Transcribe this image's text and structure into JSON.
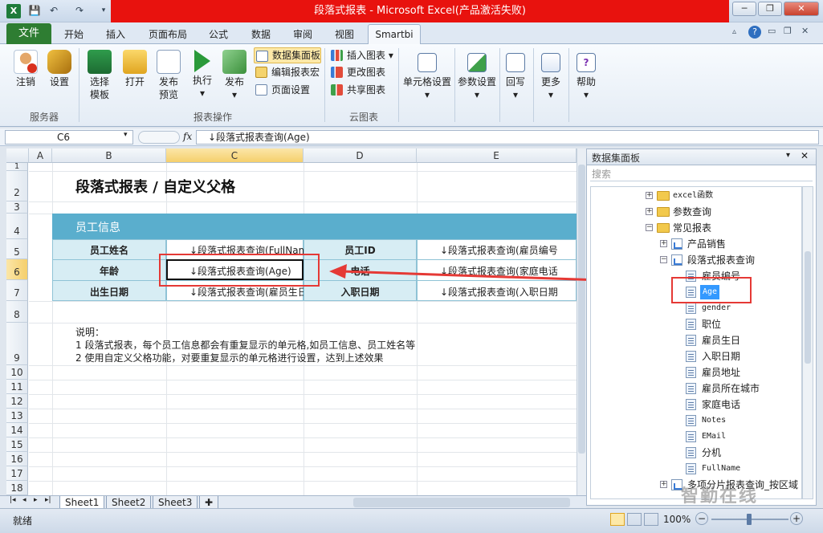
{
  "window": {
    "title": "段落式报表 - Microsoft Excel(产品激活失败)"
  },
  "qat": {
    "save": "💾",
    "undo": "↶",
    "redo": "↷"
  },
  "tabs": [
    "开始",
    "插入",
    "页面布局",
    "公式",
    "数据",
    "审阅",
    "视图"
  ],
  "file_tab": "文件",
  "smartbi_tab": "Smartbi",
  "ribbon": {
    "server": {
      "logout": "注销",
      "settings": "设置",
      "group": "服务器"
    },
    "report": {
      "select_template": "选择",
      "select_template2": "模板",
      "open": "打开",
      "publish_preview": "发布",
      "publish_preview2": "预览",
      "execute": "执行",
      "publish": "发布",
      "dataset_panel": "数据集面板",
      "edit_macro": "编辑报表宏",
      "page_setup": "页面设置",
      "group": "报表操作"
    },
    "cloud": {
      "insert_chart": "插入图表",
      "change_chart": "更改图表",
      "share_chart": "共享图表",
      "group": "云图表"
    },
    "cell_settings": "单元格设置",
    "param_settings": "参数设置",
    "writeback": "回写",
    "more": "更多",
    "help": "帮助"
  },
  "formula_bar": {
    "name_box": "C6",
    "fx": "fx",
    "formula": "↓段落式报表查询(Age)"
  },
  "columns": [
    "A",
    "B",
    "C",
    "D",
    "E"
  ],
  "rows": [
    "1",
    "2",
    "3",
    "4",
    "5",
    "6",
    "7",
    "8",
    "9",
    "10",
    "11",
    "12",
    "13",
    "14",
    "15",
    "16",
    "17",
    "18"
  ],
  "sheet": {
    "title": "段落式报表 / 自定义父格",
    "section_header": "员工信息",
    "r5": [
      "员工姓名",
      "↓段落式报表查询(FullNam",
      "员工ID",
      "↓段落式报表查询(雇员编号"
    ],
    "r6": [
      "年龄",
      "↓段落式报表查询(Age)",
      "电话",
      "↓段落式报表查询(家庭电话"
    ],
    "r7": [
      "出生日期",
      "↓段落式报表查询(雇员生日",
      "入职日期",
      "↓段落式报表查询(入职日期"
    ],
    "notes": [
      "说明：",
      "1 段落式报表，每个员工信息都会有重复显示的单元格,如员工信息、员工姓名等",
      "2 使用自定义父格功能，对要重复显示的单元格进行设置，达到上述效果"
    ]
  },
  "sheet_tabs": [
    "Sheet1",
    "Sheet2",
    "Sheet3"
  ],
  "status": {
    "ready": "就绪",
    "zoom": "100%"
  },
  "panel": {
    "title": "数据集面板",
    "search_placeholder": "搜索",
    "tree": [
      {
        "label": "excel函数",
        "type": "folder",
        "expanded": false
      },
      {
        "label": "参数查询",
        "type": "folder",
        "expanded": false
      },
      {
        "label": "常见报表",
        "type": "folder",
        "expanded": true
      },
      {
        "label": "产品销售",
        "type": "report",
        "expanded": false
      },
      {
        "label": "段落式报表查询",
        "type": "report",
        "expanded": true
      },
      {
        "label": "雇员编号",
        "type": "field"
      },
      {
        "label": "Age",
        "type": "field",
        "selected": true
      },
      {
        "label": "gender",
        "type": "field"
      },
      {
        "label": "职位",
        "type": "field"
      },
      {
        "label": "雇员生日",
        "type": "field"
      },
      {
        "label": "入职日期",
        "type": "field"
      },
      {
        "label": "雇员地址",
        "type": "field"
      },
      {
        "label": "雇员所在城市",
        "type": "field"
      },
      {
        "label": "家庭电话",
        "type": "field"
      },
      {
        "label": "Notes",
        "type": "field"
      },
      {
        "label": "EMail",
        "type": "field"
      },
      {
        "label": "分机",
        "type": "field"
      },
      {
        "label": "FullName",
        "type": "field"
      },
      {
        "label": "多项分片报表查询_按区域",
        "type": "report",
        "expanded": false
      }
    ]
  },
  "watermark": "智勤在线",
  "colors": {
    "accent_red": "#e8120e",
    "header_teal": "#5aaecd",
    "label_fill": "#d7edf4",
    "highlight": "#e53935"
  }
}
